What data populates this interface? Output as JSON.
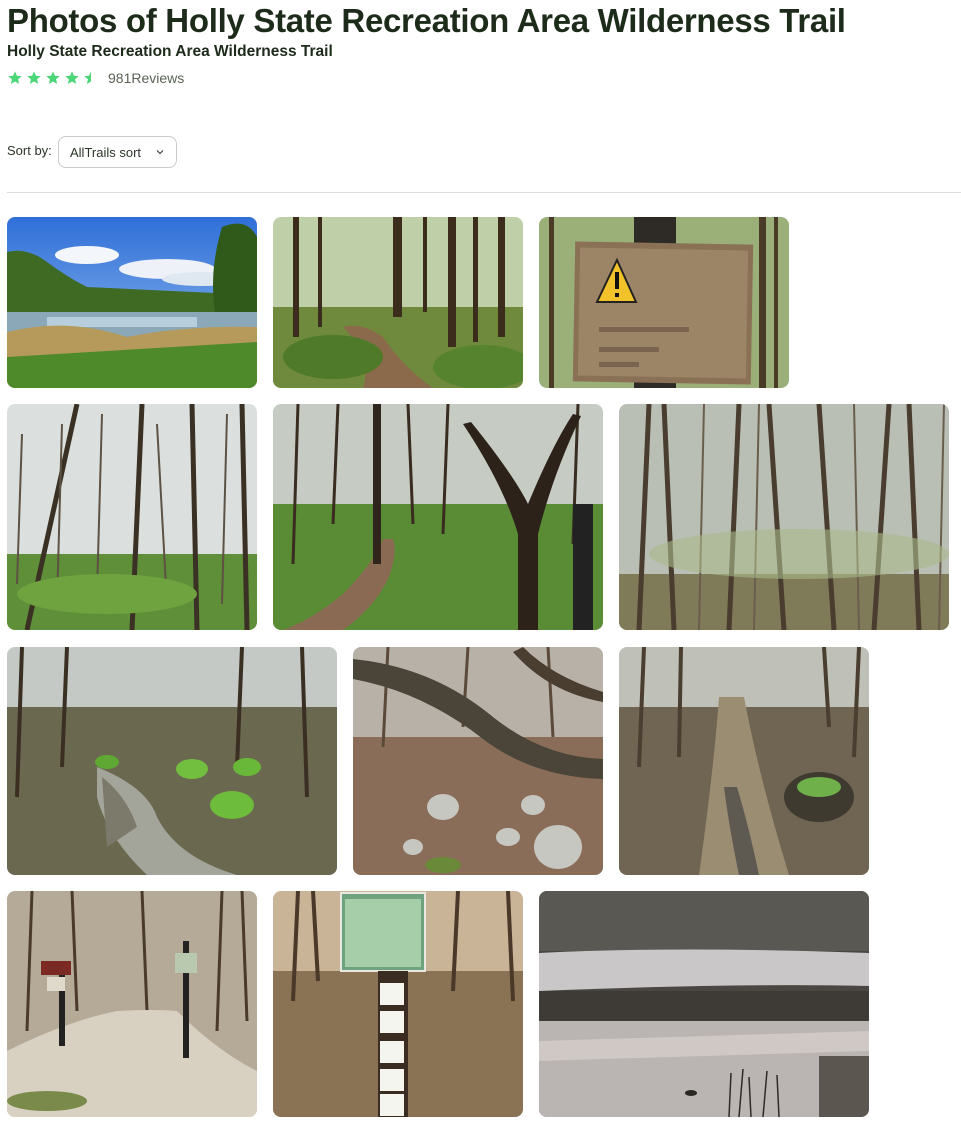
{
  "header": {
    "title": "Photos of Holly State Recreation Area Wilderness Trail",
    "subtitle": "Holly State Recreation Area Wilderness Trail"
  },
  "rating": {
    "stars": 4.5,
    "max_stars": 5,
    "reviews_label": "981Reviews",
    "star_color": "#4bd678"
  },
  "sort": {
    "label": "Sort by:",
    "selected": "AllTrails sort",
    "icon": "chevron-down-icon"
  },
  "photos": [
    {
      "name": "photo-lake-marsh",
      "scene": "lake"
    },
    {
      "name": "photo-forest-path",
      "scene": "forest-path"
    },
    {
      "name": "photo-warning-sign",
      "scene": "sign"
    },
    {
      "name": "photo-woods-green-floor",
      "scene": "woods"
    },
    {
      "name": "photo-winding-trail",
      "scene": "forest-path"
    },
    {
      "name": "photo-bare-forest",
      "scene": "woods"
    },
    {
      "name": "photo-muddy-creek",
      "scene": "creek"
    },
    {
      "name": "photo-fallen-log-rocks",
      "scene": "rocks"
    },
    {
      "name": "photo-muddy-trail",
      "scene": "mud-trail"
    },
    {
      "name": "photo-trailhead-signs",
      "scene": "trailhead"
    },
    {
      "name": "photo-trail-map-post",
      "scene": "map-post"
    },
    {
      "name": "photo-pond-goose",
      "scene": "pond"
    }
  ]
}
